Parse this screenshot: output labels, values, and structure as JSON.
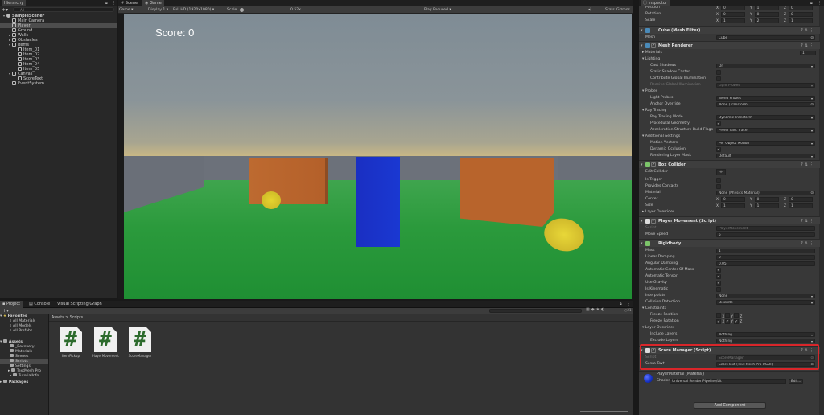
{
  "hierarchy": {
    "tab": "Hierarchy",
    "search_placeholder": "All",
    "rows": [
      {
        "label": "SampleScene*",
        "indent": 0,
        "arrow": "▾",
        "sel": false
      },
      {
        "label": "Main Camera",
        "indent": 1,
        "arrow": "",
        "sel": false
      },
      {
        "label": "Player",
        "indent": 1,
        "arrow": "",
        "sel": true
      },
      {
        "label": "Ground",
        "indent": 1,
        "arrow": "",
        "sel": false
      },
      {
        "label": "Walls",
        "indent": 1,
        "arrow": "▸",
        "sel": false
      },
      {
        "label": "Obstacles",
        "indent": 1,
        "arrow": "▸",
        "sel": false
      },
      {
        "label": "Items",
        "indent": 1,
        "arrow": "▾",
        "sel": false
      },
      {
        "label": "Item_01",
        "indent": 2,
        "arrow": "",
        "sel": false
      },
      {
        "label": "Item_02",
        "indent": 2,
        "arrow": "",
        "sel": false
      },
      {
        "label": "Item_03",
        "indent": 2,
        "arrow": "",
        "sel": false
      },
      {
        "label": "Item_04",
        "indent": 2,
        "arrow": "",
        "sel": false
      },
      {
        "label": "Item_05",
        "indent": 2,
        "arrow": "",
        "sel": false
      },
      {
        "label": "Canvas",
        "indent": 1,
        "arrow": "▾",
        "sel": false
      },
      {
        "label": "ScoreText",
        "indent": 2,
        "arrow": "",
        "sel": false
      },
      {
        "label": "EventSystem",
        "indent": 1,
        "arrow": "",
        "sel": false
      }
    ]
  },
  "center": {
    "tabs": [
      "Scene",
      "Game"
    ],
    "game_label": "Game",
    "display": "Display 1",
    "resolution": "Full HD (1920x1080)",
    "scale_label": "Scale",
    "scale_value": "0.52x",
    "play_mode": "Play Focused",
    "stats": "Stats",
    "gizmos": "Gizmos",
    "score_text": "Score: 0"
  },
  "bottom": {
    "tabs": [
      "Project",
      "Console",
      "Visual Scripting Graph"
    ],
    "breadcrumb_root": "Assets",
    "breadcrumb_sep": ">",
    "breadcrumb_leaf": "Scripts",
    "count": "21",
    "favorites_label": "Favorites",
    "favorites": [
      "All Materials",
      "All Models",
      "All Prefabs"
    ],
    "assets_label": "Assets",
    "asset_folders": [
      "_Recovery",
      "Materials",
      "Scenes",
      "Scripts",
      "Settings",
      "TextMesh Pro",
      "TutorialInfo"
    ],
    "packages_label": "Packages",
    "files": [
      "ItemPickup",
      "PlayerMovement",
      "ScoreManager"
    ]
  },
  "inspector": {
    "tab": "Inspector",
    "transform": {
      "position_label": "Position",
      "rotation_label": "Rotation",
      "scale_label": "Scale",
      "pos": [
        "0",
        "1",
        "0"
      ],
      "rot": [
        "0",
        "0",
        "0"
      ],
      "scl": [
        "1",
        "2",
        "1"
      ]
    },
    "mesh_filter": {
      "title": "Cube (Mesh Filter)",
      "mesh_label": "Mesh",
      "mesh_value": "Cube"
    },
    "mesh_renderer": {
      "title": "Mesh Renderer",
      "materials_label": "Materials",
      "materials_count": "1",
      "lighting": "Lighting",
      "cast_shadows": "Cast Shadows",
      "cast_shadows_value": "On",
      "static_shadow": "Static Shadow Caster",
      "contribute_gi": "Contribute Global Illumination",
      "receive_gi": "Receive Global Illumination",
      "receive_gi_value": "Light Probes",
      "probes": "Probes",
      "light_probes": "Light Probes",
      "light_probes_value": "Blend Probes",
      "anchor_override": "Anchor Override",
      "anchor_value": "None (Transform)",
      "ray_tracing": "Ray Tracing",
      "rt_mode": "Ray Tracing Mode",
      "rt_mode_value": "Dynamic Transform",
      "procedural": "Procedural Geometry",
      "accel": "Acceleration Structure Build Flags",
      "accel_value": "Prefer Fast Trace",
      "additional": "Additional Settings",
      "motion": "Motion Vectors",
      "motion_value": "Per Object Motion",
      "dyn_occ": "Dynamic Occlusion",
      "layer_mask": "Rendering Layer Mask",
      "layer_mask_value": "Default"
    },
    "box_collider": {
      "title": "Box Collider",
      "edit": "Edit Collider",
      "is_trigger": "Is Trigger",
      "provides": "Provides Contacts",
      "material": "Material",
      "material_value": "None (Physics Material)",
      "center": "Center",
      "center_v": [
        "0",
        "0",
        "0"
      ],
      "size": "Size",
      "size_v": [
        "1",
        "1",
        "1"
      ],
      "layer_overrides": "Layer Overrides"
    },
    "player_movement": {
      "title": "Player Movement (Script)",
      "script": "Script",
      "script_value": "PlayerMovement",
      "speed": "Move Speed",
      "speed_value": "5"
    },
    "rigidbody": {
      "title": "Rigidbody",
      "mass": "Mass",
      "mass_v": "1",
      "linear": "Linear Damping",
      "linear_v": "0",
      "angular": "Angular Damping",
      "angular_v": "0.05",
      "auto_com": "Automatic Center Of Mass",
      "auto_tensor": "Automatic Tensor",
      "gravity": "Use Gravity",
      "kinematic": "Is Kinematic",
      "interpolate": "Interpolate",
      "interpolate_v": "None",
      "collision": "Collision Detection",
      "collision_v": "Discrete",
      "constraints": "Constraints",
      "freeze_pos": "Freeze Position",
      "freeze_rot": "Freeze Rotation",
      "layer_overrides": "Layer Overrides",
      "include": "Include Layers",
      "include_v": "Nothing",
      "exclude": "Exclude Layers",
      "exclude_v": "Nothing"
    },
    "score_manager": {
      "title": "Score Manager (Script)",
      "script": "Script",
      "script_value": "ScoreManager",
      "score_text": "Score Text",
      "score_text_value": "ScoreText (Text Mesh Pro UGUI)"
    },
    "material": {
      "name": "PlayerMaterial (Material)",
      "shader_label": "Shader",
      "shader_value": "Universal Render Pipeline/Lit",
      "edit": "Edit..."
    },
    "add_component": "Add Component",
    "highlight_color": "#d9262a"
  },
  "scene_colors": {
    "sky": "#7f8c95",
    "horizon": "#d8c080",
    "ground": "#2f9a3d",
    "wall": "#6e737c",
    "crate": "#b8642c",
    "player": "#1a35c7",
    "coin": "#d8c62a"
  }
}
